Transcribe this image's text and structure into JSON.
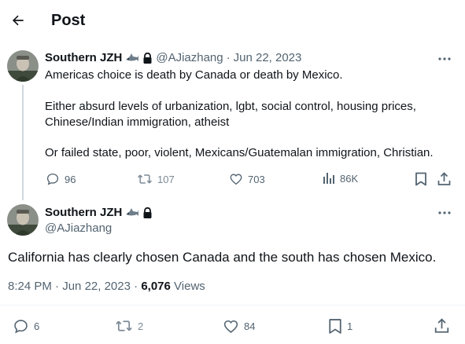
{
  "header": {
    "title": "Post"
  },
  "parent_tweet": {
    "display_name": "Southern JZH",
    "handle": "@AJiazhang",
    "separator": "·",
    "date": "Jun 22, 2023",
    "text_lines": [
      "Americas choice is death by Canada or death by Mexico.",
      "Either absurd levels of urbanization, lgbt, social control, housing prices,",
      "Chinese/Indian immigration, atheist",
      "Or failed state, poor, violent, Mexicans/Guatemalan immigration, Christian."
    ],
    "actions": {
      "replies": "96",
      "reposts": "107",
      "likes": "703",
      "views": "86K"
    }
  },
  "focus_tweet": {
    "display_name": "Southern JZH",
    "handle": "@AJiazhang",
    "text": "California has clearly chosen Canada and the south has chosen Mexico.",
    "time": "8:24 PM",
    "dot1": "·",
    "date": "Jun 22, 2023",
    "dot2": "·",
    "views_count": "6,076",
    "views_label": "Views",
    "actions": {
      "replies": "6",
      "reposts": "2",
      "likes": "84",
      "bookmarks": "1"
    }
  },
  "icons": {
    "back": "arrow-left-icon",
    "badge": "shark-emoji-icon",
    "lock": "lock-icon",
    "more": "more-dots-icon",
    "reply": "reply-bubble-icon",
    "repost": "repost-arrows-icon",
    "like": "heart-icon",
    "views": "bar-chart-icon",
    "bookmark": "bookmark-icon",
    "share": "share-upload-icon"
  },
  "colors": {
    "text": "#0f1419",
    "secondary": "#536471",
    "thread_line": "#cfd9de",
    "divider": "#eff3f4"
  }
}
